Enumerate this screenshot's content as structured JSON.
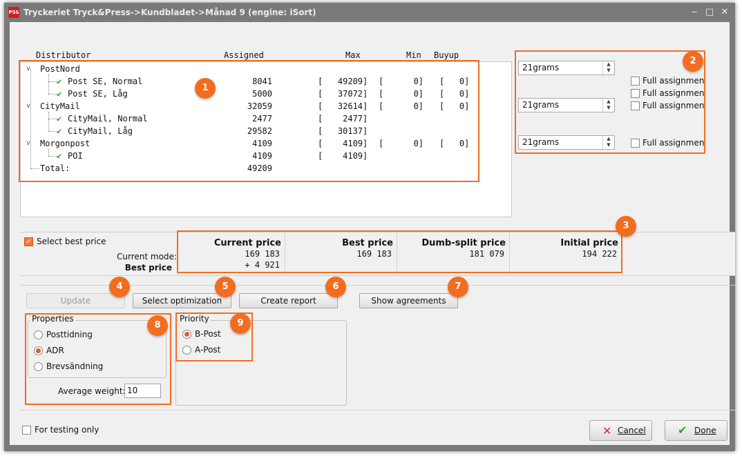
{
  "window": {
    "title": "Tryckeriet Tryck&Press->Kundbladet->Månad 9 (engine: iSort)",
    "app_icon_text": "PSS",
    "minimize_glyph": "‒",
    "maximize_glyph": "□",
    "close_glyph": "✕"
  },
  "tree": {
    "headers": {
      "distributor": "Distributor",
      "assigned": "Assigned",
      "max": "Max",
      "min": "Min",
      "buyup": "Buyup"
    },
    "rows": [
      {
        "name": "PostNord",
        "assigned": "",
        "max": "",
        "min": "",
        "buyup": ""
      },
      {
        "name": "Post SE, Normal",
        "assigned": "8041",
        "max": "[   49209]",
        "min": "[      0]",
        "buyup": "[   0]"
      },
      {
        "name": "Post SE, Låg",
        "assigned": "5000",
        "max": "[   37072]",
        "min": "[      0]",
        "buyup": "[   0]"
      },
      {
        "name": "CityMail",
        "assigned": "32059",
        "max": "[   32614]",
        "min": "[      0]",
        "buyup": "[   0]"
      },
      {
        "name": "CityMail, Normal",
        "assigned": "2477",
        "max": "[    2477]",
        "min": "",
        "buyup": ""
      },
      {
        "name": "CityMail, Låg",
        "assigned": "29582",
        "max": "[   30137]",
        "min": "",
        "buyup": ""
      },
      {
        "name": "Morgonpost",
        "assigned": "4109",
        "max": "[    4109]",
        "min": "[      0]",
        "buyup": "[   0]"
      },
      {
        "name": "POI",
        "assigned": "4109",
        "max": "[    4109]",
        "min": "",
        "buyup": ""
      },
      {
        "name": "Total:",
        "assigned": "49209",
        "max": "",
        "min": "",
        "buyup": ""
      }
    ],
    "expander_glyph": "v",
    "check_glyph": "✔"
  },
  "right_panel": {
    "combos": [
      "21grams",
      "21grams",
      "21grams"
    ],
    "full_assign_label": "Full assignmen"
  },
  "price": {
    "select_best_label": "Select best price",
    "current_mode_label": "Current mode:",
    "current_mode_value": "Best price",
    "current": {
      "title": "Current price",
      "value": "169 183",
      "extra": "+ 4 921"
    },
    "best": {
      "title": "Best price",
      "value": "169 183"
    },
    "dumb": {
      "title": "Dumb-split price",
      "value": "181 079"
    },
    "initial": {
      "title": "Initial price",
      "value": "194 222"
    }
  },
  "buttons": {
    "update": "Update",
    "select_optimization": "Select optimization",
    "create_report": "Create report",
    "show_agreements": "Show agreements",
    "cancel": "Cancel",
    "done": "Done"
  },
  "properties": {
    "title": "Properties",
    "options": [
      "Posttidning",
      "ADR",
      "Brevsändning"
    ],
    "average_weight_label": "Average weight:",
    "average_weight_value": "10"
  },
  "priority": {
    "title": "Priority",
    "options": [
      "B-Post",
      "A-Post"
    ]
  },
  "testing_label": "For testing only",
  "callouts": [
    "1",
    "2",
    "3",
    "4",
    "5",
    "6",
    "7",
    "8",
    "9"
  ],
  "colors": {
    "accent": "#f26d1f",
    "check": "#22a022",
    "radio": "#e2582a"
  }
}
